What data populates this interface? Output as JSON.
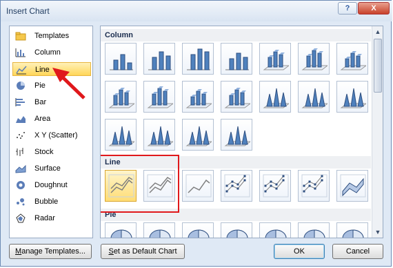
{
  "window": {
    "title": "Insert Chart",
    "help_label": "?",
    "close_label": "X"
  },
  "sidebar": {
    "items": [
      {
        "label": "Templates",
        "icon": "folder-icon"
      },
      {
        "label": "Column",
        "icon": "column-chart-icon"
      },
      {
        "label": "Line",
        "icon": "line-chart-icon",
        "selected": true
      },
      {
        "label": "Pie",
        "icon": "pie-chart-icon"
      },
      {
        "label": "Bar",
        "icon": "bar-chart-icon"
      },
      {
        "label": "Area",
        "icon": "area-chart-icon"
      },
      {
        "label": "X Y (Scatter)",
        "icon": "scatter-chart-icon"
      },
      {
        "label": "Stock",
        "icon": "stock-chart-icon"
      },
      {
        "label": "Surface",
        "icon": "surface-chart-icon"
      },
      {
        "label": "Doughnut",
        "icon": "doughnut-chart-icon"
      },
      {
        "label": "Bubble",
        "icon": "bubble-chart-icon"
      },
      {
        "label": "Radar",
        "icon": "radar-chart-icon"
      }
    ]
  },
  "gallery": {
    "sections": [
      {
        "name": "Column",
        "tile_count": 18
      },
      {
        "name": "Line",
        "tile_count": 7
      },
      {
        "name": "Pie",
        "tile_count": 7
      }
    ]
  },
  "annotation": {
    "arrow_color": "#e0181b",
    "highlight_color": "#e0181b"
  },
  "buttons": {
    "manage_prefix": "M",
    "manage_rest": "anage Templates...",
    "default_prefix": "S",
    "default_rest": "et as Default Chart",
    "ok": "OK",
    "cancel": "Cancel"
  },
  "colors": {
    "selection": "#ffd659",
    "chart_blue": "#4f81bd"
  }
}
